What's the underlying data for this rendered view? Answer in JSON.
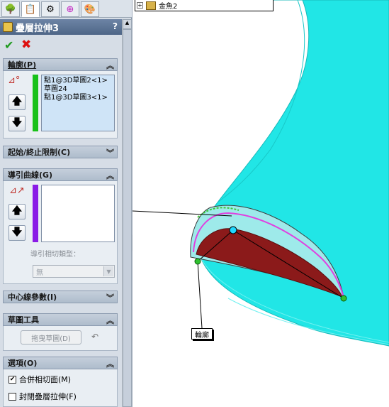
{
  "tabs": [
    {
      "icon": "feature-tree-icon"
    },
    {
      "icon": "property-manager-icon"
    },
    {
      "icon": "configuration-icon"
    },
    {
      "icon": "dimxpert-icon"
    },
    {
      "icon": "display-manager-icon"
    }
  ],
  "property_manager": {
    "title": "疊層拉伸3",
    "help": "?"
  },
  "groups": {
    "profiles": {
      "header": "輪廓(P)",
      "items": [
        "點1@3D草圖2<1>",
        "草圖24",
        "點1@3D草圖3<1>"
      ]
    },
    "start_end": {
      "header": "起始/終止限制(C)"
    },
    "guide_curves": {
      "header": "導引曲線(G)",
      "tangency_label": "導引相切類型：",
      "tangency_value": "無"
    },
    "centerline": {
      "header": "中心線參數(I)"
    },
    "sketch_tools": {
      "header": "草圖工具",
      "drag_button": "拖曳草圖(D)",
      "undo": "↶"
    },
    "options": {
      "header": "選項(O)",
      "merge_tangent": {
        "label": "合併相切面(M)",
        "checked": true
      },
      "close_loft": {
        "label": "封閉疊層拉伸(F)",
        "checked": false
      }
    }
  },
  "tree_flyout": {
    "item": "金魚2"
  },
  "callout": {
    "label": "輪廓"
  },
  "colors": {
    "profile_bar": "#19c119",
    "guide_bar": "#8a1be6",
    "body": "#21e6e6",
    "section_fill": "#8b1a1a"
  }
}
